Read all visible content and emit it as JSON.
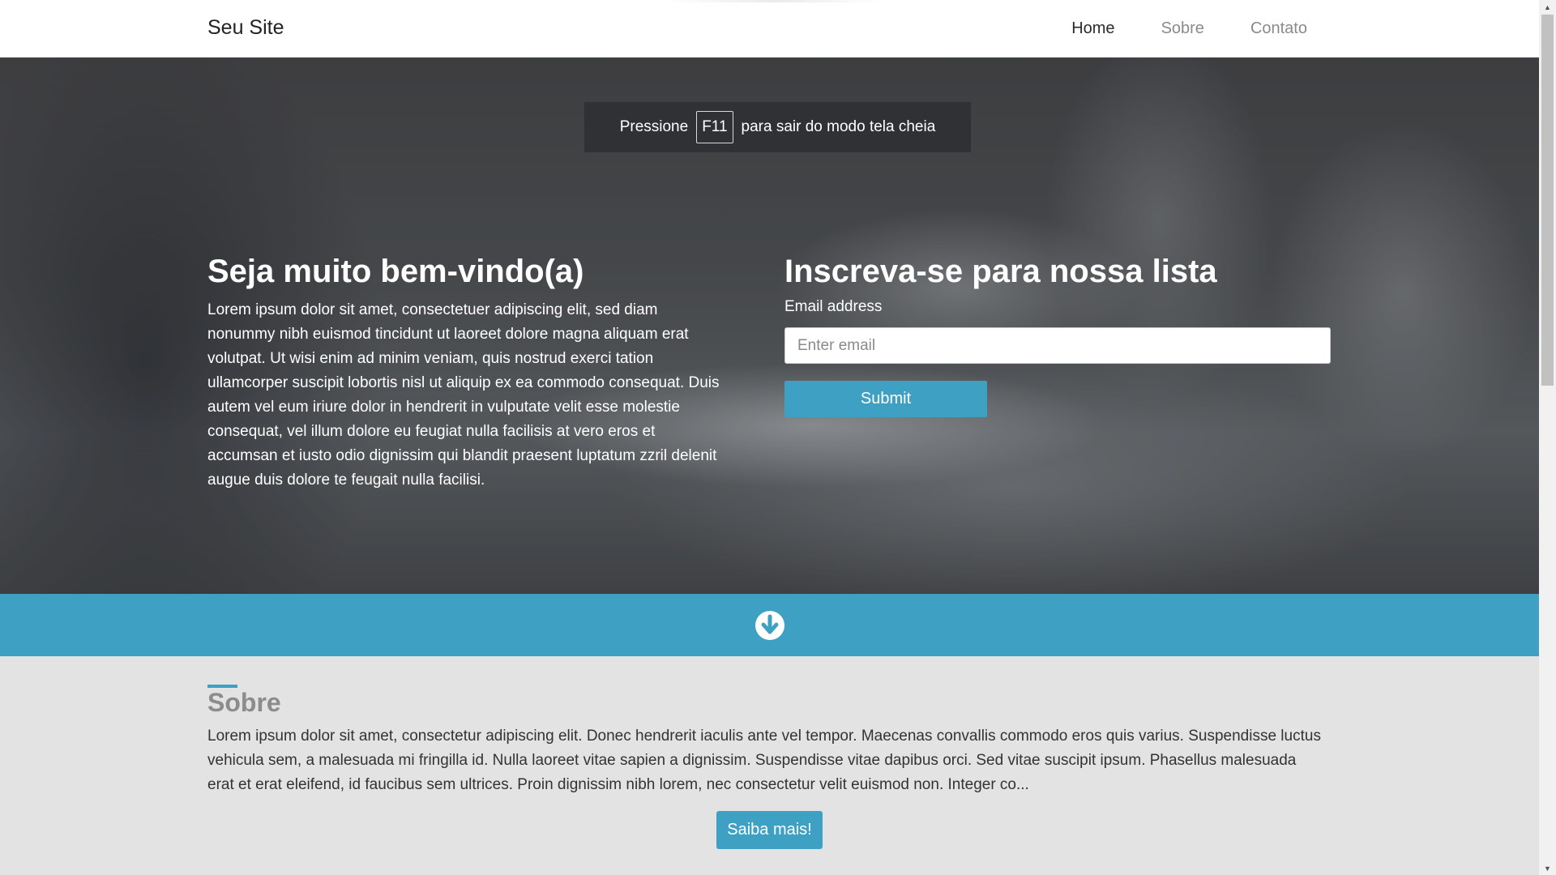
{
  "navbar": {
    "brand": "Seu Site",
    "links": [
      {
        "label": "Home",
        "active": true
      },
      {
        "label": "Sobre",
        "active": false
      },
      {
        "label": "Contato",
        "active": false
      }
    ]
  },
  "fullscreen_notice": {
    "prefix": "Pressione",
    "key": "F11",
    "suffix": "para sair do modo tela cheia"
  },
  "hero": {
    "title": "Seja muito bem-vindo(a)",
    "text": "Lorem ipsum dolor sit amet, consectetuer adipiscing elit, sed diam nonummy nibh euismod tincidunt ut laoreet dolore magna aliquam erat volutpat. Ut wisi enim ad minim veniam, quis nostrud exerci tation ullamcorper suscipit lobortis nisl ut aliquip ex ea commodo consequat. Duis autem vel eum iriure dolor in hendrerit in vulputate velit esse molestie consequat, vel illum dolore eu feugiat nulla facilisis at vero eros et accumsan et iusto odio dignissim qui blandit praesent luptatum zzril delenit augue duis dolore te feugait nulla facilisi."
  },
  "signup": {
    "title": "Inscreva-se para nossa lista",
    "email_label": "Email address",
    "email_placeholder": "Enter email",
    "email_value": "",
    "submit_label": "Submit"
  },
  "scroll_band": {
    "icon": "arrow-circle-down-icon"
  },
  "about": {
    "title": "Sobre",
    "text": "Lorem ipsum dolor sit amet, consectetur adipiscing elit. Donec hendrerit iaculis ante vel tempor. Maecenas convallis commodo eros quis varius. Suspendisse luctus vehicula sem, a malesuada mi fringilla id. Nulla laoreet vitae sapien a dignissim. Suspendisse vitae dapibus orci. Sed vitae suscipit ipsum. Phasellus malesuada erat et erat eleifend, id faucibus sem ultrices. Proin dignissim nibh lorem, nec consectetur velit euismod non. Integer co...",
    "button_label": "Saiba mais!"
  },
  "colors": {
    "accent": "#3ea1c4",
    "navbar_bg": "#ffffff",
    "section_bg": "#e3e3e3"
  }
}
